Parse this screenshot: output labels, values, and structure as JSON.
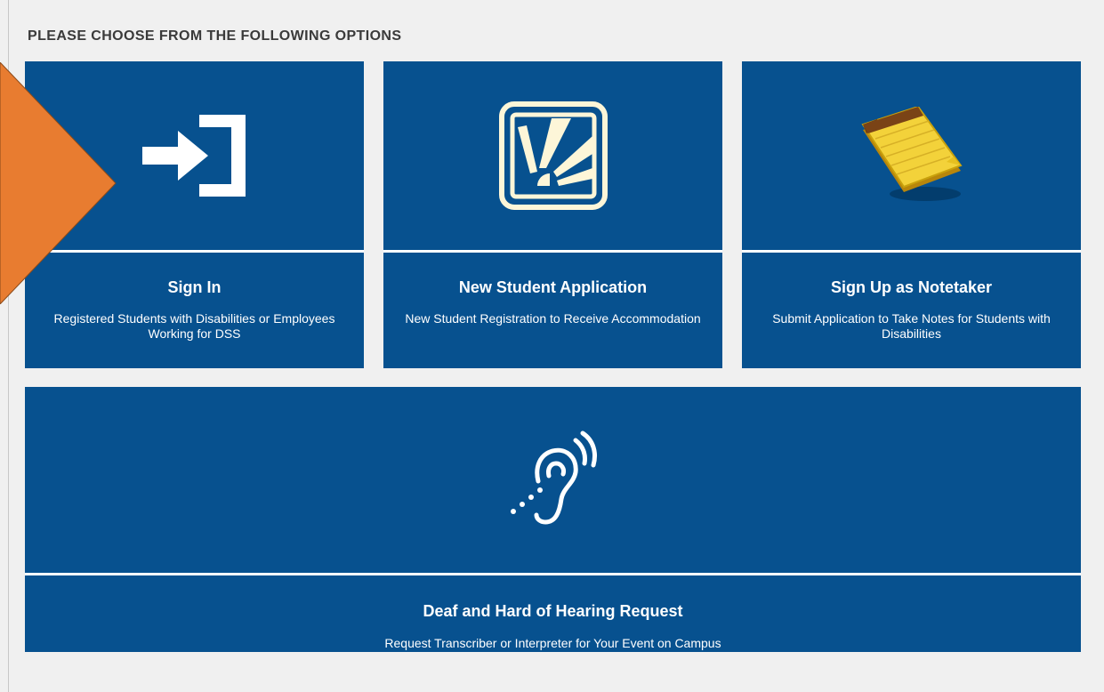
{
  "heading": "PLEASE CHOOSE FROM THE FOLLOWING OPTIONS",
  "tiles": {
    "signin": {
      "title": "Sign In",
      "desc": "Registered Students with Disabilities or Employees Working for DSS",
      "icon": "sign-in-icon"
    },
    "newstudent": {
      "title": "New Student Application",
      "desc": "New Student Registration to Receive Accommodation",
      "icon": "sunrise-icon"
    },
    "notetaker": {
      "title": "Sign Up as Notetaker",
      "desc": "Submit Application to Take Notes for Students with Disabilities",
      "icon": "notepad-icon"
    },
    "deaf": {
      "title": "Deaf and Hard of Hearing Request",
      "desc": "Request Transcriber or Interpreter for Your Event on Campus",
      "icon": "hearing-icon"
    }
  },
  "colors": {
    "tile_bg": "#07518f",
    "page_bg": "#f0f0f0",
    "pointer": "#e87c30"
  }
}
